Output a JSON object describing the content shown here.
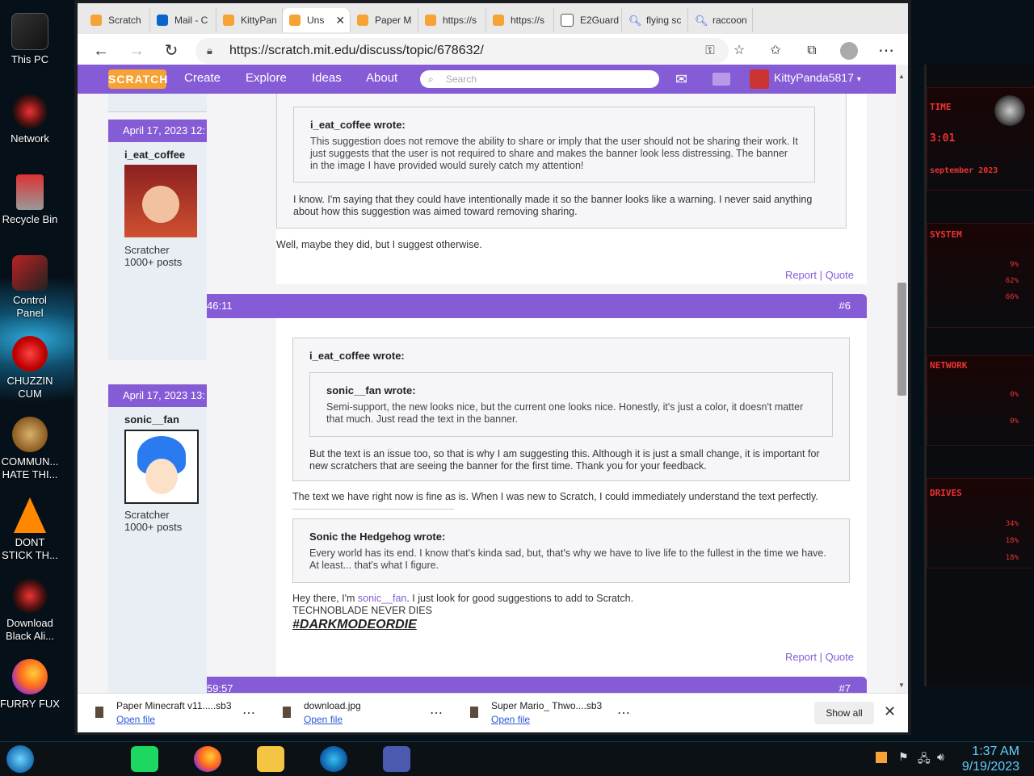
{
  "desktop": {
    "icons": [
      {
        "label": "This PC"
      },
      {
        "label": "Network"
      },
      {
        "label": "Recycle Bin"
      },
      {
        "label": "Control Panel"
      },
      {
        "label": "CHUZZIN CUM"
      },
      {
        "label": "COMMUN... HATE THI..."
      },
      {
        "label": "DONT STICK TH..."
      },
      {
        "label": "Download Black Ali..."
      },
      {
        "label": "FURRY FUX"
      }
    ]
  },
  "widget": {
    "labels": [
      "TIME",
      "3:01",
      "september 2023",
      "SYSTEM",
      "NETWORK",
      "DRIVES"
    ],
    "pcts": [
      "9%",
      "62%",
      "66%",
      "0%",
      "0%",
      "34%",
      "18%",
      "18%"
    ]
  },
  "browser": {
    "tabs": [
      {
        "label": "Scratch"
      },
      {
        "label": "Mail - C"
      },
      {
        "label": "KittyPan"
      },
      {
        "label": "Uns",
        "active": true
      },
      {
        "label": "Paper M"
      },
      {
        "label": "https://s"
      },
      {
        "label": "https://s"
      },
      {
        "label": "E2Guard"
      },
      {
        "label": "flying sc"
      },
      {
        "label": "raccoon"
      }
    ],
    "url": "https://scratch.mit.edu/discuss/topic/678632/"
  },
  "scratch_nav": {
    "logo": "SCRATCH",
    "items": [
      "Create",
      "Explore",
      "Ideas",
      "About"
    ],
    "search_placeholder": "Search",
    "username": "KittyPanda5817"
  },
  "posts": [
    {
      "date": "April 17, 2023 12:",
      "author": "i_eat_coffee",
      "rank": "Scratcher",
      "posts": "1000+ posts",
      "inner_quote_header": "i_eat_coffee wrote:",
      "inner_quote_text": "This suggestion does not remove the ability to share or imply that the user should not be sharing their work. It just suggests that the user is not required to share and makes the banner look less distressing. The banner in the image I have provided would surely catch my attention!",
      "outer_quote_text": "I know. I'm saying that they could have intentionally made it so the banner looks like a warning. I never said anything about how this suggestion was aimed toward removing sharing.",
      "reply": "Well, maybe they did, but I suggest otherwise.",
      "report": "Report",
      "quote": "Quote"
    },
    {
      "time": "46:11",
      "number": "#6",
      "date": "April 17, 2023 13:",
      "author": "sonic__fan",
      "rank": "Scratcher",
      "posts": "1000+ posts",
      "outer_quote_header": "i_eat_coffee wrote:",
      "inner_quote_header": "sonic__fan wrote:",
      "inner_quote_text": "Semi-support, the new looks nice, but the current one looks nice. Honestly, it's just a color, it doesn't matter that much. Just read the text in the banner.",
      "outer_quote_text": "But the text is an issue too, so that is why I am suggesting this. Although it is just a small change, it is important for new scratchers that are seeing the banner for the first time. Thank you for your feedback.",
      "reply": "The text we have right now is fine as is. When I was new to Scratch, I could immediately understand the text perfectly.",
      "sig_quote_header": "Sonic the Hedgehog wrote:",
      "sig_quote_text": "Every world has its end. I know that's kinda sad, but, that's why we have to live life to the fullest in the time we have. At least... that's what I figure.",
      "sig_line1_pre": "Hey there, I'm ",
      "sig_line1_link": "sonic__fan",
      "sig_line1_post": ". I just look for good suggestions to add to Scratch.",
      "sig_line2": "TECHNOBLADE NEVER DIES",
      "sig_line3": "#DARKMODEORDIE",
      "report": "Report",
      "quote": "Quote"
    },
    {
      "time": "59:57",
      "number": "#7"
    }
  ],
  "downloads": {
    "items": [
      {
        "name": "Paper Minecraft v11.....sb3",
        "action": "Open file"
      },
      {
        "name": "download.jpg",
        "action": "Open file"
      },
      {
        "name": "Super Mario_ Thwo....sb3",
        "action": "Open file"
      }
    ],
    "show_all": "Show all"
  },
  "taskbar": {
    "time": "1:37 AM",
    "date": "9/19/2023"
  },
  "colors": {
    "scratch_purple": "#855cd6",
    "link_blue": "#2a5bd7"
  }
}
